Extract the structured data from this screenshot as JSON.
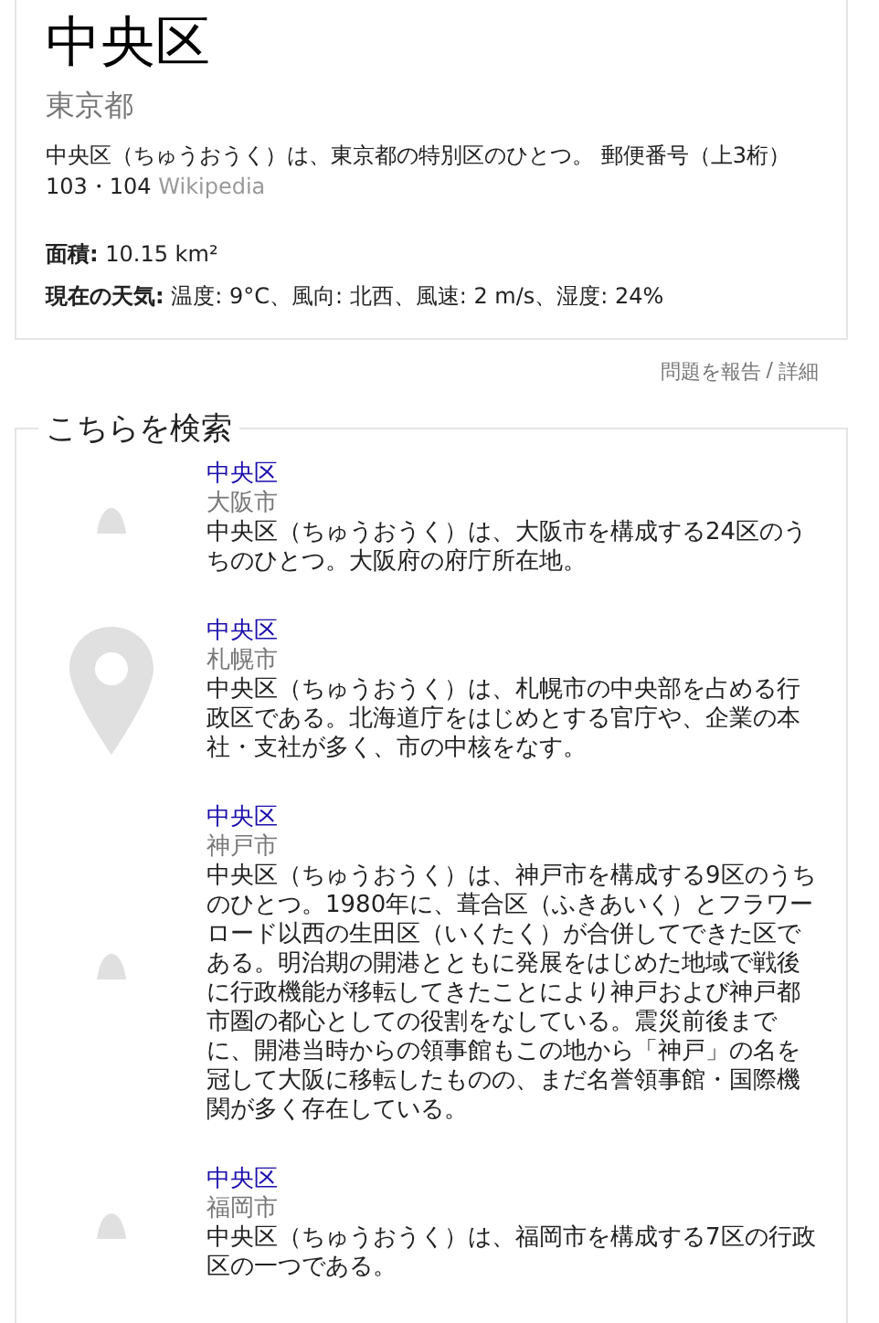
{
  "entity": {
    "title": "中央区",
    "subtitle": "東京都",
    "description": "中央区（ちゅうおうく）は、東京都の特別区のひとつ。 郵便番号（上3桁）103・104",
    "source": "Wikipedia",
    "facts": [
      {
        "label": "面積:",
        "value": "10.15 km²"
      },
      {
        "label": "現在の天気:",
        "value": "温度: 9°C、風向: 北西、風速: 2 m/s、湿度: 24%"
      }
    ]
  },
  "feedback": {
    "report": "問題を報告",
    "separator": "/",
    "details": "詳細"
  },
  "related": {
    "heading": "こちらを検索",
    "items": [
      {
        "kind": "mound",
        "title": "中央区",
        "city": "大阪市",
        "text": "中央区（ちゅうおうく）は、大阪市を構成する24区のうちのひとつ。大阪府の府庁所在地。"
      },
      {
        "kind": "pin",
        "title": "中央区",
        "city": "札幌市",
        "text": "中央区（ちゅうおうく）は、札幌市の中央部を占める行政区である。北海道庁をはじめとする官庁や、企業の本社・支社が多く、市の中核をなす。"
      },
      {
        "kind": "mound",
        "title": "中央区",
        "city": "神戸市",
        "text": "中央区（ちゅうおうく）は、神戸市を構成する9区のうちのひとつ。1980年に、葺合区（ふきあいく）とフラワーロード以西の生田区（いくたく）が合併してできた区である。明治期の開港とともに発展をはじめた地域で戦後に行政機能が移転してきたことにより神戸および神戸都市圏の都心としての役割をなしている。震災前後までに、開港当時からの領事館もこの地から「神戸」の名を冠して大阪に移転したものの、まだ名誉領事館・国際機関が多く存在している。"
      },
      {
        "kind": "mound",
        "title": "中央区",
        "city": "福岡市",
        "text": "中央区（ちゅうおうく）は、福岡市を構成する7区の行政区の一つである。"
      }
    ]
  }
}
